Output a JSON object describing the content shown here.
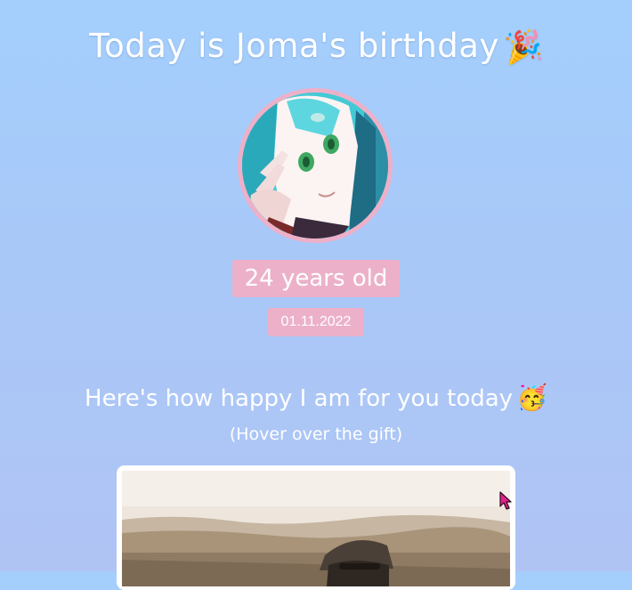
{
  "header": {
    "title": "Today is Joma's birthday",
    "title_emoji": "🎉"
  },
  "profile": {
    "avatar_icon": "anime-avatar",
    "age_label": "24 years old",
    "date_label": "01.11.2022"
  },
  "section": {
    "heading": "Here's how happy I am for you today",
    "heading_emoji": "🥳",
    "hint": "(Hover over the gift)"
  },
  "gift": {
    "image_icon": "gift-photo"
  },
  "colors": {
    "background_top": "#a4cffd",
    "background_bottom": "#b0c4f4",
    "accent_pink": "#ecb1c9",
    "avatar_border": "#eeb0c8",
    "text": "#ffffff",
    "cursor": "#e0228c"
  }
}
